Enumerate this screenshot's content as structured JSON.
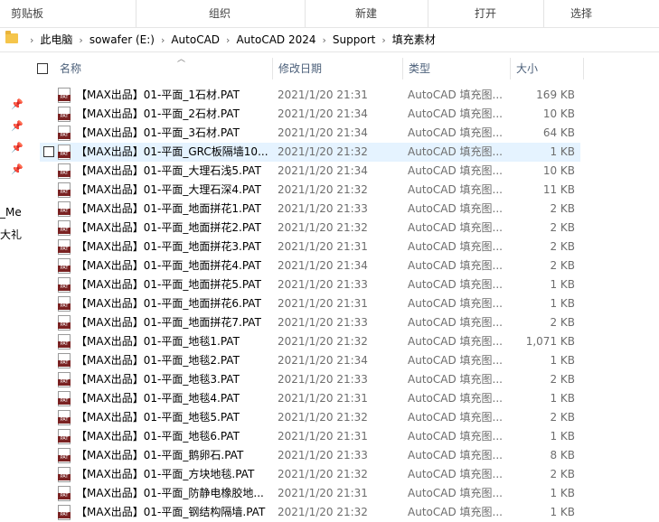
{
  "ribbon": {
    "groups": [
      "剪贴板",
      "组织",
      "新建",
      "打开",
      "选择"
    ]
  },
  "address": {
    "crumbs": [
      "此电脑",
      "sowafer (E:)",
      "AutoCAD",
      "AutoCAD 2024",
      "Support",
      "填充素材"
    ]
  },
  "left_pane": {
    "cut_labels": [
      "_Me",
      "大礼"
    ]
  },
  "columns": {
    "name": "名称",
    "date": "修改日期",
    "type": "类型",
    "size": "大小"
  },
  "files": [
    {
      "name": "【MAX出品】01-平面_1石材.PAT",
      "date": "2021/1/20 21:31",
      "type": "AutoCAD 填充图...",
      "size": "169 KB"
    },
    {
      "name": "【MAX出品】01-平面_2石材.PAT",
      "date": "2021/1/20 21:34",
      "type": "AutoCAD 填充图...",
      "size": "10 KB"
    },
    {
      "name": "【MAX出品】01-平面_3石材.PAT",
      "date": "2021/1/20 21:34",
      "type": "AutoCAD 填充图...",
      "size": "64 KB"
    },
    {
      "name": "【MAX出品】01-平面_GRC板隔墙10...",
      "date": "2021/1/20 21:32",
      "type": "AutoCAD 填充图...",
      "size": "1 KB",
      "hover": true
    },
    {
      "name": "【MAX出品】01-平面_大理石浅5.PAT",
      "date": "2021/1/20 21:34",
      "type": "AutoCAD 填充图...",
      "size": "10 KB"
    },
    {
      "name": "【MAX出品】01-平面_大理石深4.PAT",
      "date": "2021/1/20 21:32",
      "type": "AutoCAD 填充图...",
      "size": "11 KB"
    },
    {
      "name": "【MAX出品】01-平面_地面拼花1.PAT",
      "date": "2021/1/20 21:33",
      "type": "AutoCAD 填充图...",
      "size": "2 KB"
    },
    {
      "name": "【MAX出品】01-平面_地面拼花2.PAT",
      "date": "2021/1/20 21:32",
      "type": "AutoCAD 填充图...",
      "size": "2 KB"
    },
    {
      "name": "【MAX出品】01-平面_地面拼花3.PAT",
      "date": "2021/1/20 21:31",
      "type": "AutoCAD 填充图...",
      "size": "2 KB"
    },
    {
      "name": "【MAX出品】01-平面_地面拼花4.PAT",
      "date": "2021/1/20 21:34",
      "type": "AutoCAD 填充图...",
      "size": "2 KB"
    },
    {
      "name": "【MAX出品】01-平面_地面拼花5.PAT",
      "date": "2021/1/20 21:33",
      "type": "AutoCAD 填充图...",
      "size": "1 KB"
    },
    {
      "name": "【MAX出品】01-平面_地面拼花6.PAT",
      "date": "2021/1/20 21:31",
      "type": "AutoCAD 填充图...",
      "size": "1 KB"
    },
    {
      "name": "【MAX出品】01-平面_地面拼花7.PAT",
      "date": "2021/1/20 21:33",
      "type": "AutoCAD 填充图...",
      "size": "2 KB"
    },
    {
      "name": "【MAX出品】01-平面_地毯1.PAT",
      "date": "2021/1/20 21:32",
      "type": "AutoCAD 填充图...",
      "size": "1,071 KB"
    },
    {
      "name": "【MAX出品】01-平面_地毯2.PAT",
      "date": "2021/1/20 21:34",
      "type": "AutoCAD 填充图...",
      "size": "1 KB"
    },
    {
      "name": "【MAX出品】01-平面_地毯3.PAT",
      "date": "2021/1/20 21:33",
      "type": "AutoCAD 填充图...",
      "size": "2 KB"
    },
    {
      "name": "【MAX出品】01-平面_地毯4.PAT",
      "date": "2021/1/20 21:31",
      "type": "AutoCAD 填充图...",
      "size": "1 KB"
    },
    {
      "name": "【MAX出品】01-平面_地毯5.PAT",
      "date": "2021/1/20 21:32",
      "type": "AutoCAD 填充图...",
      "size": "2 KB"
    },
    {
      "name": "【MAX出品】01-平面_地毯6.PAT",
      "date": "2021/1/20 21:31",
      "type": "AutoCAD 填充图...",
      "size": "1 KB"
    },
    {
      "name": "【MAX出品】01-平面_鹅卵石.PAT",
      "date": "2021/1/20 21:33",
      "type": "AutoCAD 填充图...",
      "size": "8 KB"
    },
    {
      "name": "【MAX出品】01-平面_方块地毯.PAT",
      "date": "2021/1/20 21:32",
      "type": "AutoCAD 填充图...",
      "size": "2 KB"
    },
    {
      "name": "【MAX出品】01-平面_防静电橡胶地...",
      "date": "2021/1/20 21:31",
      "type": "AutoCAD 填充图...",
      "size": "1 KB"
    },
    {
      "name": "【MAX出品】01-平面_钢结构隔墙.PAT",
      "date": "2021/1/20 21:32",
      "type": "AutoCAD 填充图...",
      "size": "1 KB"
    }
  ]
}
